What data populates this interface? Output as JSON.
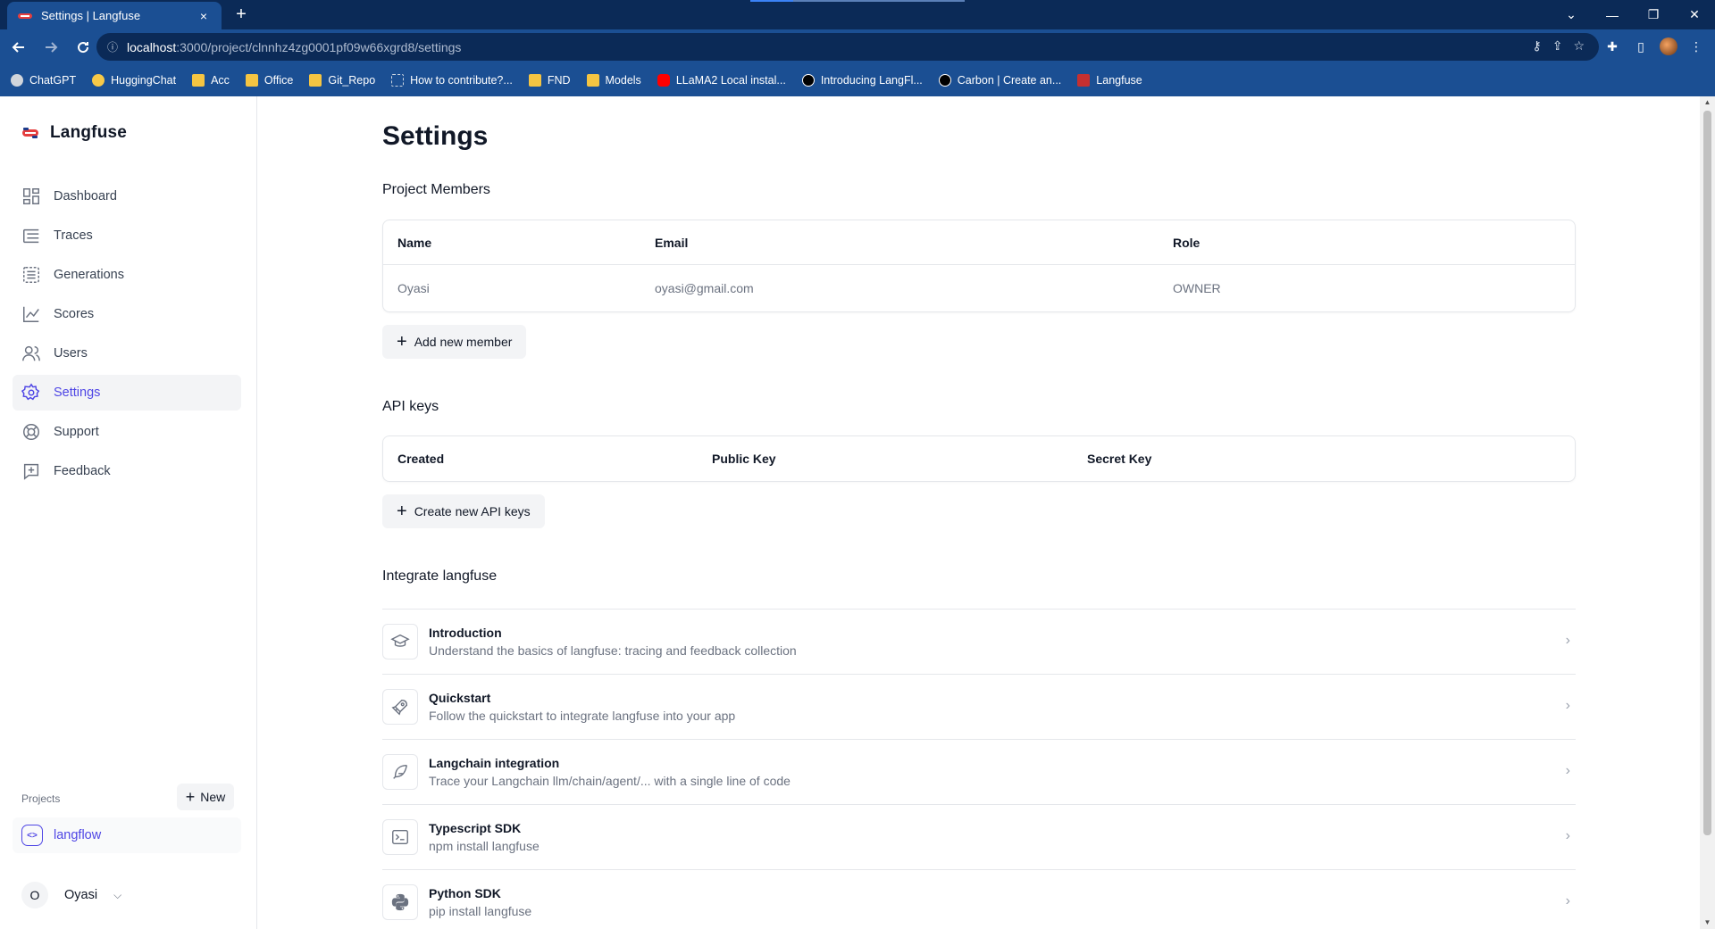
{
  "browser": {
    "tab_title": "Settings | Langfuse",
    "tab_close": "×",
    "new_tab": "+",
    "url_host": "localhost",
    "url_path": ":3000/project/clnnhz4zg0001pf09w66xgrd8/settings",
    "bookmarks": [
      {
        "label": "ChatGPT",
        "icon": "chatgpt-icon"
      },
      {
        "label": "HuggingChat",
        "icon": "huggingchat-icon"
      },
      {
        "label": "Acc",
        "icon": "folder-icon"
      },
      {
        "label": "Office",
        "icon": "folder-icon"
      },
      {
        "label": "Git_Repo",
        "icon": "folder-icon"
      },
      {
        "label": "How to contribute?...",
        "icon": "github-icon"
      },
      {
        "label": "FND",
        "icon": "folder-icon"
      },
      {
        "label": "Models",
        "icon": "folder-icon"
      },
      {
        "label": "LLaMA2 Local instal...",
        "icon": "youtube-icon"
      },
      {
        "label": "Introducing LangFl...",
        "icon": "medium-icon"
      },
      {
        "label": "Carbon | Create an...",
        "icon": "carbon-icon"
      },
      {
        "label": "Langfuse",
        "icon": "langfuse-icon"
      }
    ]
  },
  "sidebar": {
    "brand": "Langfuse",
    "nav": [
      {
        "label": "Dashboard",
        "icon": "dashboard-icon",
        "active": false
      },
      {
        "label": "Traces",
        "icon": "traces-icon",
        "active": false
      },
      {
        "label": "Generations",
        "icon": "generations-icon",
        "active": false
      },
      {
        "label": "Scores",
        "icon": "scores-icon",
        "active": false
      },
      {
        "label": "Users",
        "icon": "users-icon",
        "active": false
      },
      {
        "label": "Settings",
        "icon": "gear-icon",
        "active": true
      },
      {
        "label": "Support",
        "icon": "lifebuoy-icon",
        "active": false
      },
      {
        "label": "Feedback",
        "icon": "feedback-icon",
        "active": false
      }
    ],
    "projects_label": "Projects",
    "new_project_label": "New",
    "project": {
      "name": "langflow"
    },
    "user": {
      "initial": "O",
      "name": "Oyasi"
    }
  },
  "main": {
    "title": "Settings",
    "members": {
      "title": "Project Members",
      "headers": [
        "Name",
        "Email",
        "Role"
      ],
      "rows": [
        [
          "Oyasi",
          "oyasi@gmail.com",
          "OWNER"
        ]
      ],
      "add_button": "Add new member"
    },
    "api_keys": {
      "title": "API keys",
      "headers": [
        "Created",
        "Public Key",
        "Secret Key"
      ],
      "create_button": "Create new API keys"
    },
    "integrate": {
      "title": "Integrate langfuse",
      "items": [
        {
          "title": "Introduction",
          "desc": "Understand the basics of langfuse: tracing and feedback collection",
          "icon": "graduation-cap-icon"
        },
        {
          "title": "Quickstart",
          "desc": "Follow the quickstart to integrate langfuse into your app",
          "icon": "rocket-icon"
        },
        {
          "title": "Langchain integration",
          "desc": "Trace your Langchain llm/chain/agent/... with a single line of code",
          "icon": "bird-icon"
        },
        {
          "title": "Typescript SDK",
          "desc": "npm install langfuse",
          "icon": "terminal-icon"
        },
        {
          "title": "Python SDK",
          "desc": "pip install langfuse",
          "icon": "python-icon"
        }
      ]
    }
  },
  "colors": {
    "accent": "#4f46e5",
    "chrome_dark": "#0b2a57",
    "chrome": "#1b4f93"
  }
}
